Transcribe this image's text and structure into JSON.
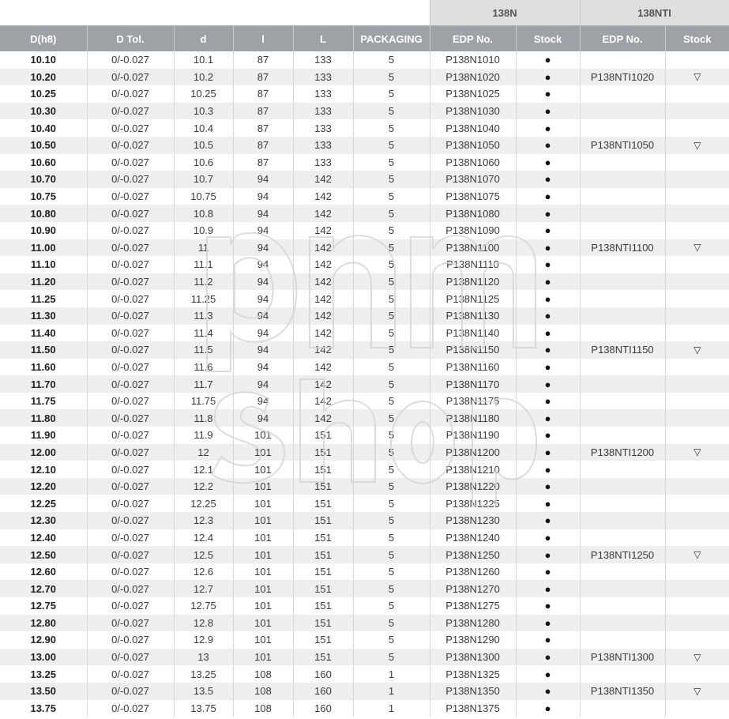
{
  "groups": {
    "g1": "138N",
    "g2": "138NTI"
  },
  "headers": [
    "D(h8)",
    "D Tol.",
    "d",
    "l",
    "L",
    "PACKAGING",
    "EDP No.",
    "Stock",
    "EDP No.",
    "Stock"
  ],
  "symbols": {
    "in_stock": "●",
    "on_order": "▽"
  },
  "rows": [
    {
      "D": "10.10",
      "tol": "0/-0.027",
      "d": "10.1",
      "l": "87",
      "L": "133",
      "pack": "5",
      "edp": "P138N1010",
      "stock": "●",
      "edp_ti": "",
      "stock_ti": ""
    },
    {
      "D": "10.20",
      "tol": "0/-0.027",
      "d": "10.2",
      "l": "87",
      "L": "133",
      "pack": "5",
      "edp": "P138N1020",
      "stock": "●",
      "edp_ti": "P138NTI1020",
      "stock_ti": "▽"
    },
    {
      "D": "10.25",
      "tol": "0/-0.027",
      "d": "10.25",
      "l": "87",
      "L": "133",
      "pack": "5",
      "edp": "P138N1025",
      "stock": "●",
      "edp_ti": "",
      "stock_ti": ""
    },
    {
      "D": "10.30",
      "tol": "0/-0.027",
      "d": "10.3",
      "l": "87",
      "L": "133",
      "pack": "5",
      "edp": "P138N1030",
      "stock": "●",
      "edp_ti": "",
      "stock_ti": ""
    },
    {
      "D": "10.40",
      "tol": "0/-0.027",
      "d": "10.4",
      "l": "87",
      "L": "133",
      "pack": "5",
      "edp": "P138N1040",
      "stock": "●",
      "edp_ti": "",
      "stock_ti": ""
    },
    {
      "D": "10.50",
      "tol": "0/-0.027",
      "d": "10.5",
      "l": "87",
      "L": "133",
      "pack": "5",
      "edp": "P138N1050",
      "stock": "●",
      "edp_ti": "P138NTI1050",
      "stock_ti": "▽"
    },
    {
      "D": "10.60",
      "tol": "0/-0.027",
      "d": "10.6",
      "l": "87",
      "L": "133",
      "pack": "5",
      "edp": "P138N1060",
      "stock": "●",
      "edp_ti": "",
      "stock_ti": ""
    },
    {
      "D": "10.70",
      "tol": "0/-0.027",
      "d": "10.7",
      "l": "94",
      "L": "142",
      "pack": "5",
      "edp": "P138N1070",
      "stock": "●",
      "edp_ti": "",
      "stock_ti": ""
    },
    {
      "D": "10.75",
      "tol": "0/-0.027",
      "d": "10.75",
      "l": "94",
      "L": "142",
      "pack": "5",
      "edp": "P138N1075",
      "stock": "●",
      "edp_ti": "",
      "stock_ti": ""
    },
    {
      "D": "10.80",
      "tol": "0/-0.027",
      "d": "10.8",
      "l": "94",
      "L": "142",
      "pack": "5",
      "edp": "P138N1080",
      "stock": "●",
      "edp_ti": "",
      "stock_ti": ""
    },
    {
      "D": "10.90",
      "tol": "0/-0.027",
      "d": "10.9",
      "l": "94",
      "L": "142",
      "pack": "5",
      "edp": "P138N1090",
      "stock": "●",
      "edp_ti": "",
      "stock_ti": ""
    },
    {
      "D": "11.00",
      "tol": "0/-0.027",
      "d": "11",
      "l": "94",
      "L": "142",
      "pack": "5",
      "edp": "P138N1100",
      "stock": "●",
      "edp_ti": "P138NTI1100",
      "stock_ti": "▽"
    },
    {
      "D": "11.10",
      "tol": "0/-0.027",
      "d": "11.1",
      "l": "94",
      "L": "142",
      "pack": "5",
      "edp": "P138N1110",
      "stock": "●",
      "edp_ti": "",
      "stock_ti": ""
    },
    {
      "D": "11.20",
      "tol": "0/-0.027",
      "d": "11.2",
      "l": "94",
      "L": "142",
      "pack": "5",
      "edp": "P138N1120",
      "stock": "●",
      "edp_ti": "",
      "stock_ti": ""
    },
    {
      "D": "11.25",
      "tol": "0/-0.027",
      "d": "11.25",
      "l": "94",
      "L": "142",
      "pack": "5",
      "edp": "P138N1125",
      "stock": "●",
      "edp_ti": "",
      "stock_ti": ""
    },
    {
      "D": "11.30",
      "tol": "0/-0.027",
      "d": "11.3",
      "l": "94",
      "L": "142",
      "pack": "5",
      "edp": "P138N1130",
      "stock": "●",
      "edp_ti": "",
      "stock_ti": ""
    },
    {
      "D": "11.40",
      "tol": "0/-0.027",
      "d": "11.4",
      "l": "94",
      "L": "142",
      "pack": "5",
      "edp": "P138N1140",
      "stock": "●",
      "edp_ti": "",
      "stock_ti": ""
    },
    {
      "D": "11.50",
      "tol": "0/-0.027",
      "d": "11.5",
      "l": "94",
      "L": "142",
      "pack": "5",
      "edp": "P138N1150",
      "stock": "●",
      "edp_ti": "P138NTI1150",
      "stock_ti": "▽"
    },
    {
      "D": "11.60",
      "tol": "0/-0.027",
      "d": "11.6",
      "l": "94",
      "L": "142",
      "pack": "5",
      "edp": "P138N1160",
      "stock": "●",
      "edp_ti": "",
      "stock_ti": ""
    },
    {
      "D": "11.70",
      "tol": "0/-0.027",
      "d": "11.7",
      "l": "94",
      "L": "142",
      "pack": "5",
      "edp": "P138N1170",
      "stock": "●",
      "edp_ti": "",
      "stock_ti": ""
    },
    {
      "D": "11.75",
      "tol": "0/-0.027",
      "d": "11.75",
      "l": "94",
      "L": "142",
      "pack": "5",
      "edp": "P138N1175",
      "stock": "●",
      "edp_ti": "",
      "stock_ti": ""
    },
    {
      "D": "11.80",
      "tol": "0/-0.027",
      "d": "11.8",
      "l": "94",
      "L": "142",
      "pack": "5",
      "edp": "P138N1180",
      "stock": "●",
      "edp_ti": "",
      "stock_ti": ""
    },
    {
      "D": "11.90",
      "tol": "0/-0.027",
      "d": "11.9",
      "l": "101",
      "L": "151",
      "pack": "5",
      "edp": "P138N1190",
      "stock": "●",
      "edp_ti": "",
      "stock_ti": ""
    },
    {
      "D": "12.00",
      "tol": "0/-0.027",
      "d": "12",
      "l": "101",
      "L": "151",
      "pack": "5",
      "edp": "P138N1200",
      "stock": "●",
      "edp_ti": "P138NTI1200",
      "stock_ti": "▽"
    },
    {
      "D": "12.10",
      "tol": "0/-0.027",
      "d": "12.1",
      "l": "101",
      "L": "151",
      "pack": "5",
      "edp": "P138N1210",
      "stock": "●",
      "edp_ti": "",
      "stock_ti": ""
    },
    {
      "D": "12.20",
      "tol": "0/-0.027",
      "d": "12.2",
      "l": "101",
      "L": "151",
      "pack": "5",
      "edp": "P138N1220",
      "stock": "●",
      "edp_ti": "",
      "stock_ti": ""
    },
    {
      "D": "12.25",
      "tol": "0/-0.027",
      "d": "12.25",
      "l": "101",
      "L": "151",
      "pack": "5",
      "edp": "P138N1225",
      "stock": "●",
      "edp_ti": "",
      "stock_ti": ""
    },
    {
      "D": "12.30",
      "tol": "0/-0.027",
      "d": "12.3",
      "l": "101",
      "L": "151",
      "pack": "5",
      "edp": "P138N1230",
      "stock": "●",
      "edp_ti": "",
      "stock_ti": ""
    },
    {
      "D": "12.40",
      "tol": "0/-0.027",
      "d": "12.4",
      "l": "101",
      "L": "151",
      "pack": "5",
      "edp": "P138N1240",
      "stock": "●",
      "edp_ti": "",
      "stock_ti": ""
    },
    {
      "D": "12.50",
      "tol": "0/-0.027",
      "d": "12.5",
      "l": "101",
      "L": "151",
      "pack": "5",
      "edp": "P138N1250",
      "stock": "●",
      "edp_ti": "P138NTI1250",
      "stock_ti": "▽"
    },
    {
      "D": "12.60",
      "tol": "0/-0.027",
      "d": "12.6",
      "l": "101",
      "L": "151",
      "pack": "5",
      "edp": "P138N1260",
      "stock": "●",
      "edp_ti": "",
      "stock_ti": ""
    },
    {
      "D": "12.70",
      "tol": "0/-0.027",
      "d": "12.7",
      "l": "101",
      "L": "151",
      "pack": "5",
      "edp": "P138N1270",
      "stock": "●",
      "edp_ti": "",
      "stock_ti": ""
    },
    {
      "D": "12.75",
      "tol": "0/-0.027",
      "d": "12.75",
      "l": "101",
      "L": "151",
      "pack": "5",
      "edp": "P138N1275",
      "stock": "●",
      "edp_ti": "",
      "stock_ti": ""
    },
    {
      "D": "12.80",
      "tol": "0/-0.027",
      "d": "12.8",
      "l": "101",
      "L": "151",
      "pack": "5",
      "edp": "P138N1280",
      "stock": "●",
      "edp_ti": "",
      "stock_ti": ""
    },
    {
      "D": "12.90",
      "tol": "0/-0.027",
      "d": "12.9",
      "l": "101",
      "L": "151",
      "pack": "5",
      "edp": "P138N1290",
      "stock": "●",
      "edp_ti": "",
      "stock_ti": ""
    },
    {
      "D": "13.00",
      "tol": "0/-0.027",
      "d": "13",
      "l": "101",
      "L": "151",
      "pack": "5",
      "edp": "P138N1300",
      "stock": "●",
      "edp_ti": "P138NTI1300",
      "stock_ti": "▽"
    },
    {
      "D": "13.25",
      "tol": "0/-0.027",
      "d": "13.25",
      "l": "108",
      "L": "160",
      "pack": "1",
      "edp": "P138N1325",
      "stock": "●",
      "edp_ti": "",
      "stock_ti": ""
    },
    {
      "D": "13.50",
      "tol": "0/-0.027",
      "d": "13.5",
      "l": "108",
      "L": "160",
      "pack": "1",
      "edp": "P138N1350",
      "stock": "●",
      "edp_ti": "P138NTI1350",
      "stock_ti": "▽"
    },
    {
      "D": "13.75",
      "tol": "0/-0.027",
      "d": "13.75",
      "l": "108",
      "L": "160",
      "pack": "1",
      "edp": "P138N1375",
      "stock": "●",
      "edp_ti": "",
      "stock_ti": ""
    }
  ]
}
